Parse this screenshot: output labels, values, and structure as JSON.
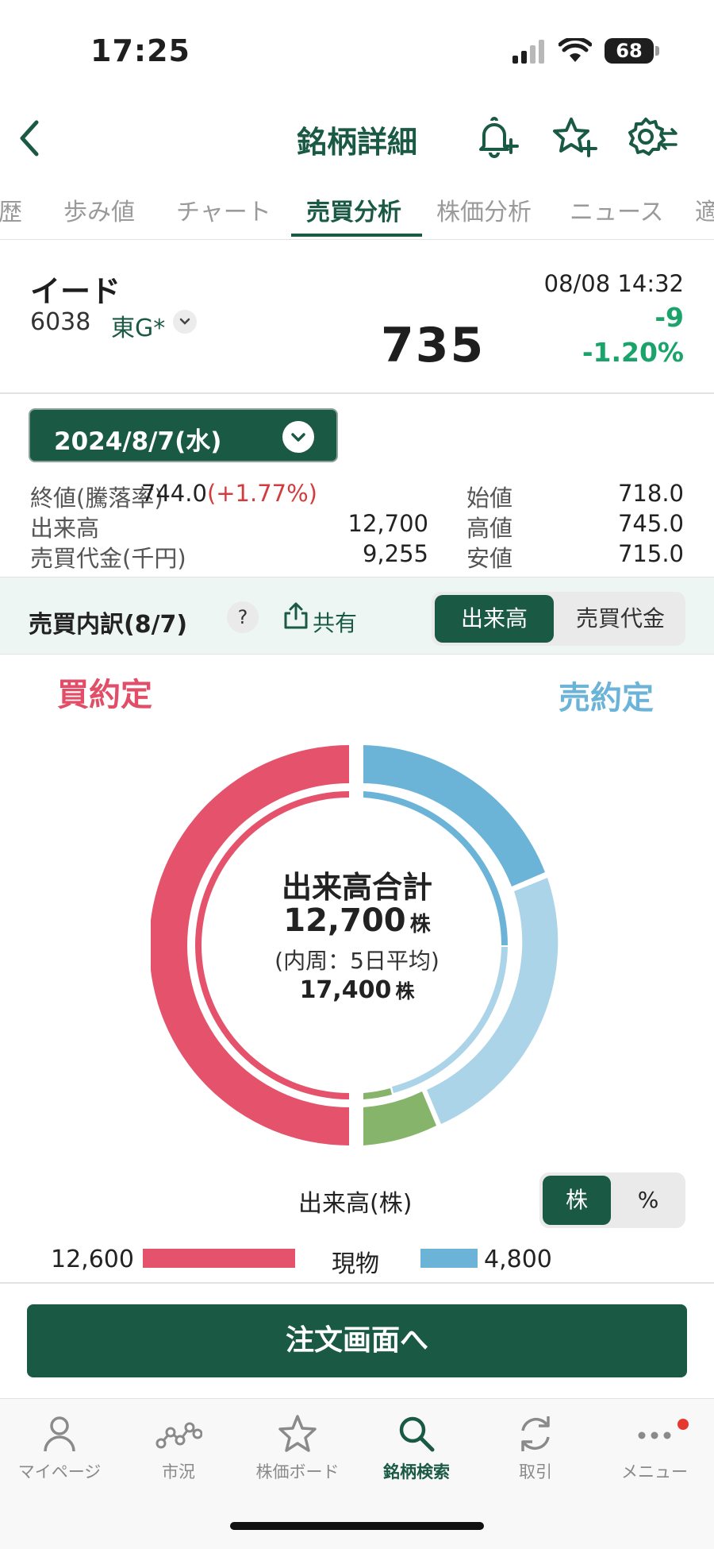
{
  "status_bar": {
    "time": "17:25",
    "battery": "68"
  },
  "header": {
    "title": "銘柄詳細"
  },
  "tabs": [
    {
      "label": "歴"
    },
    {
      "label": "歩み値"
    },
    {
      "label": "チャート"
    },
    {
      "label": "売買分析",
      "active": true
    },
    {
      "label": "株価分析"
    },
    {
      "label": "ニュース"
    },
    {
      "label": "適"
    }
  ],
  "stock": {
    "name": "イード",
    "code": "6038",
    "exchange": "東G*",
    "price": "735",
    "datetime": "08/08 14:32",
    "change": "-9",
    "change_pct": "-1.20%"
  },
  "date_selector": {
    "value": "2024/8/7(水)"
  },
  "stats": {
    "close_label": "終値(騰落率)",
    "close_value": "744.0",
    "close_change": "(+1.77%)",
    "volume_label": "出来高",
    "volume_value": "12,700",
    "amount_label": "売買代金(千円)",
    "amount_value": "9,255",
    "open_label": "始値",
    "open_value": "718.0",
    "high_label": "高値",
    "high_value": "745.0",
    "low_label": "安値",
    "low_value": "715.0"
  },
  "breakdown": {
    "title": "売買内訳(8/7)",
    "help": "?",
    "share_label": "共有",
    "seg_volume": "出来高",
    "seg_amount": "売買代金"
  },
  "donut": {
    "buy_label": "買約定",
    "sell_label": "売約定",
    "center_title": "出来高合計",
    "center_total": "12,700",
    "center_unit": "株",
    "center_sub": "(内周：5日平均)",
    "center_avg": "17,400",
    "center_avg_unit": "株"
  },
  "legend": {
    "volume_label": "出来高(株)",
    "unit_shares": "株",
    "unit_pct": "%",
    "buy_value": "12,600",
    "row_label": "現物",
    "sell_value": "4,800"
  },
  "order_button": {
    "label": "注文画面へ"
  },
  "bottom_nav": [
    {
      "label": "マイページ",
      "icon": "person-icon"
    },
    {
      "label": "市況",
      "icon": "market-graph-icon"
    },
    {
      "label": "株価ボード",
      "icon": "star-icon"
    },
    {
      "label": "銘柄検索",
      "icon": "search-icon",
      "active": true
    },
    {
      "label": "取引",
      "icon": "refresh-icon"
    },
    {
      "label": "メニュー",
      "icon": "more-icon"
    }
  ],
  "colors": {
    "brand_green": "#1a5a45",
    "buy_red": "#e4536b",
    "sell_blue": "#6bb4d8",
    "sell_light_blue": "#acd4e8",
    "other_green": "#86b46a",
    "positive_green": "#1aa36a",
    "up_red": "#d23c3c"
  }
}
